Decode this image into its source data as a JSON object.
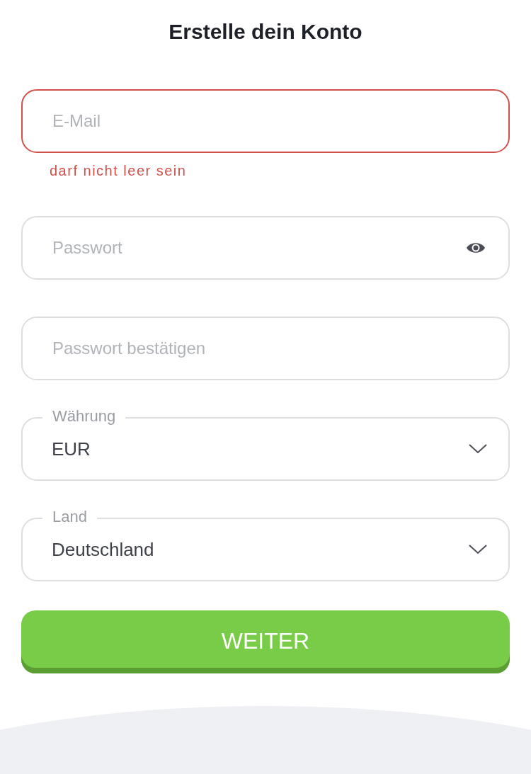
{
  "title": "Erstelle dein Konto",
  "fields": [
    {
      "kind": "input",
      "placeholder": "E-Mail",
      "error": "darf nicht leer sein"
    },
    {
      "kind": "password",
      "placeholder": "Passwort"
    },
    {
      "kind": "input",
      "placeholder": "Passwort bestätigen"
    },
    {
      "kind": "select",
      "label": "Währung",
      "value": "EUR"
    },
    {
      "kind": "select",
      "label": "Land",
      "value": "Deutschland"
    }
  ],
  "button": "WEITER"
}
